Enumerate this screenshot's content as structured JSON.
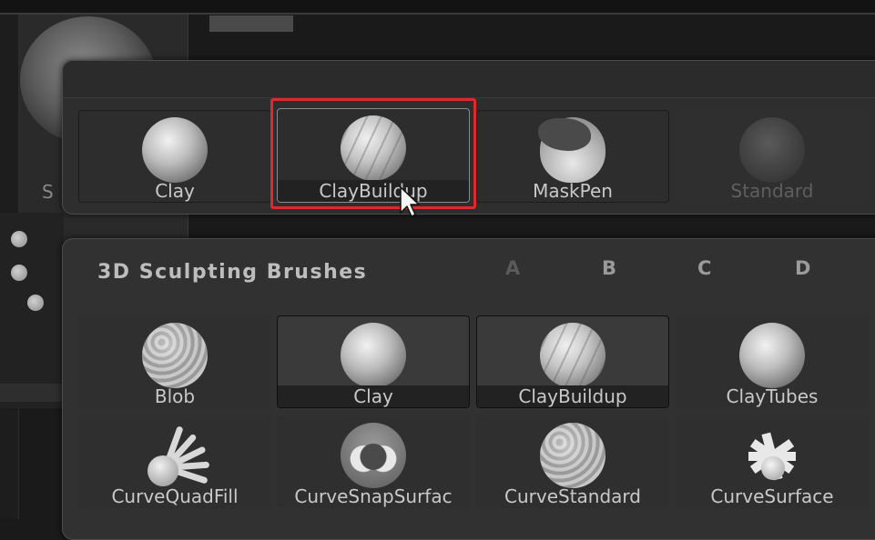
{
  "background": {
    "side_letter": "S"
  },
  "recent_brushes": [
    {
      "label": "Clay",
      "state": "normal",
      "icon": "clay-brush-icon"
    },
    {
      "label": "ClayBuildup",
      "state": "highlighted",
      "icon": "claybuildup-brush-icon"
    },
    {
      "label": "MaskPen",
      "state": "normal",
      "icon": "maskpen-brush-icon"
    },
    {
      "label": "Standard",
      "state": "disabled",
      "icon": "standard-brush-icon"
    }
  ],
  "palette": {
    "title": "3D Sculpting Brushes",
    "columns": [
      "A",
      "B",
      "C",
      "D"
    ],
    "rows": [
      [
        {
          "label": "Blob",
          "icon": "blob-brush-icon"
        },
        {
          "label": "Clay",
          "icon": "clay-brush-icon"
        },
        {
          "label": "ClayBuildup",
          "icon": "claybuildup-brush-icon"
        },
        {
          "label": "ClayTubes",
          "icon": "claytubes-brush-icon"
        }
      ],
      [
        {
          "label": "CurveQuadFill",
          "icon": "curvequadfill-brush-icon"
        },
        {
          "label": "CurveSnapSurfac",
          "icon": "curvesnapsurface-brush-icon"
        },
        {
          "label": "CurveStandard",
          "icon": "curvestandard-brush-icon"
        },
        {
          "label": "CurveSurface",
          "icon": "curvesurface-brush-icon"
        }
      ]
    ]
  },
  "colors": {
    "highlight": "#e1282a",
    "panel": "#313131",
    "label": "#c9c9c9"
  }
}
